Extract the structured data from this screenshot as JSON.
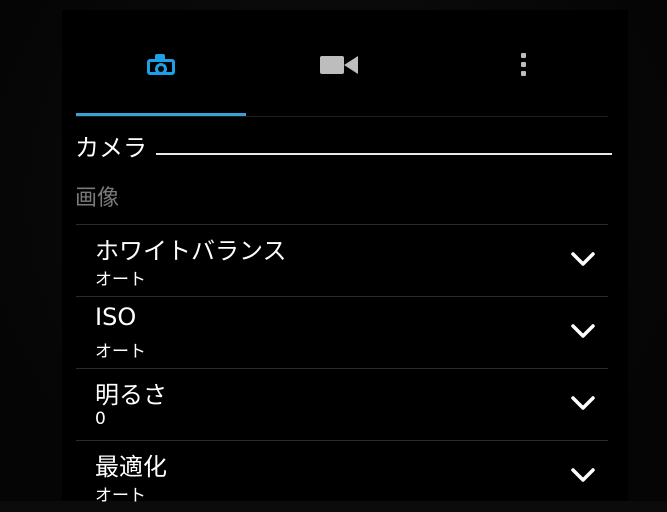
{
  "tabs": [
    {
      "icon": "camera-icon",
      "active": true
    },
    {
      "icon": "video-icon",
      "active": false
    },
    {
      "icon": "more-vertical-icon",
      "active": false
    }
  ],
  "colors": {
    "accent": "#1da1e6",
    "inactive_icon": "#bdbdbd",
    "group_label": "#7a7a7a"
  },
  "section": {
    "title": "カメラ"
  },
  "group": {
    "label": "画像"
  },
  "settings": [
    {
      "title": "ホワイトバランス",
      "value": "オート"
    },
    {
      "title": "ISO",
      "value": "オート"
    },
    {
      "title": "明るさ",
      "value": "0"
    },
    {
      "title": "最適化",
      "value": "オート"
    }
  ]
}
